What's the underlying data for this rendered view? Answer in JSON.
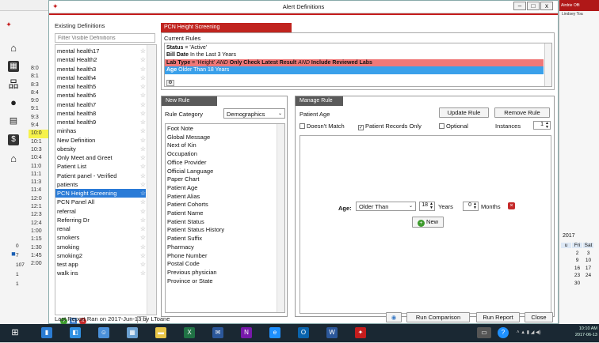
{
  "window": {
    "title": "Alert Definitions",
    "min": "–",
    "max": "□",
    "close": "x"
  },
  "bg_app": {
    "user_bar": "Airdrie Offi",
    "user_name": "Lindsey Toa",
    "times": [
      "8:0",
      "8:1",
      "8:3",
      "8:4",
      "9:0",
      "9:1",
      "9:3",
      "9:4",
      "10:0",
      "10:1",
      "10:3",
      "10:4",
      "11:0",
      "11:1",
      "11:3",
      "11:4",
      "12:0",
      "12:1",
      "12:3",
      "12:4",
      "1:00",
      "1:15",
      "1:30",
      "1:45",
      "2:00"
    ],
    "mini_counts": [
      "0",
      "7",
      "107",
      "1",
      "1"
    ],
    "calendar": {
      "year": "2017",
      "days_header": [
        "u",
        "Fri",
        "Sat"
      ],
      "rows": [
        [
          "",
          "2",
          "3"
        ],
        [
          "",
          "9",
          "10"
        ],
        [
          "",
          "16",
          "17"
        ],
        [
          "",
          "23",
          "24"
        ],
        [
          "",
          "30",
          ""
        ]
      ]
    }
  },
  "existing_definitions": {
    "title": "Existing Definitions",
    "filter_placeholder": "Filter Visible Definitions",
    "items": [
      "mental health17",
      "mental Health2",
      "mental health3",
      "mental health4",
      "mental health5",
      "mental health6",
      "mental health7",
      "mental health8",
      "mental health9",
      "minhas",
      "New Definition",
      "obesity",
      "Only Meet and Greet",
      "Patient List",
      "Patient panel - Verified",
      "patients",
      "PCN Height Screening",
      "PCN Panel All",
      "referral",
      "Referring Dr",
      "renal",
      "smokers",
      "smoking",
      "smoking2",
      "test app",
      "walk ins"
    ],
    "selected": "PCN Height Screening"
  },
  "rule_set": {
    "header": "PCN Height Screening",
    "current_rules_label": "Current Rules",
    "rules": [
      {
        "b": "Status",
        "t": " = 'Active'"
      },
      {
        "b": "Bill Date",
        "t": " In the Last 3 Years"
      },
      {
        "b": "Lab Type",
        "t": " = 'Height' ",
        "i": "AND",
        "b2": " Only Check Latest Result ",
        "i2": "AND",
        "b3": " Include Reviewed Labs"
      },
      {
        "b": "Age",
        "t": " Older Than 18 Years"
      }
    ]
  },
  "new_rule": {
    "header": "New Rule",
    "category_label": "Rule Category",
    "category_value": "Demographics",
    "categories": [
      "Foot Note",
      "Global Message",
      "Next of Kin",
      "Occupation",
      "Office Provider",
      "Official Language",
      "Paper Chart",
      "Patient Age",
      "Patient Alias",
      "Patient Cohorts",
      "Patient Name",
      "Patient Status",
      "Patient Status History",
      "Patient Suffix",
      "Pharmacy",
      "Phone Number",
      "Postal Code",
      "Previous physician",
      "Province or State"
    ]
  },
  "manage_rule": {
    "header": "Manage Rule",
    "rule_name": "Patient Age",
    "update_btn": "Update Rule",
    "remove_btn": "Remove Rule",
    "doesnt_match": "Doesn't Match",
    "patient_records_only": "Patient Records Only",
    "optional": "Optional",
    "instances_label": "Instances",
    "instances_value": "1",
    "age_label": "Age:",
    "age_op": "Older Than",
    "years_value": "18",
    "years_label": "Years",
    "months_value": "0",
    "months_label": "Months",
    "new_btn": "New"
  },
  "footer": {
    "last_report": "Last Report Ran on 2017-Jun-13 by LToane",
    "run_comparison": "Run Comparison",
    "run_report": "Run Report",
    "close": "Close"
  },
  "taskbar": {
    "time": "10:10 AM",
    "date": "2017-06-13"
  },
  "colors": {
    "accent_red": "#c0241f",
    "selection_blue": "#2a7bd7",
    "rule_red": "#ef7878",
    "rule_blue": "#3aa0ea"
  }
}
